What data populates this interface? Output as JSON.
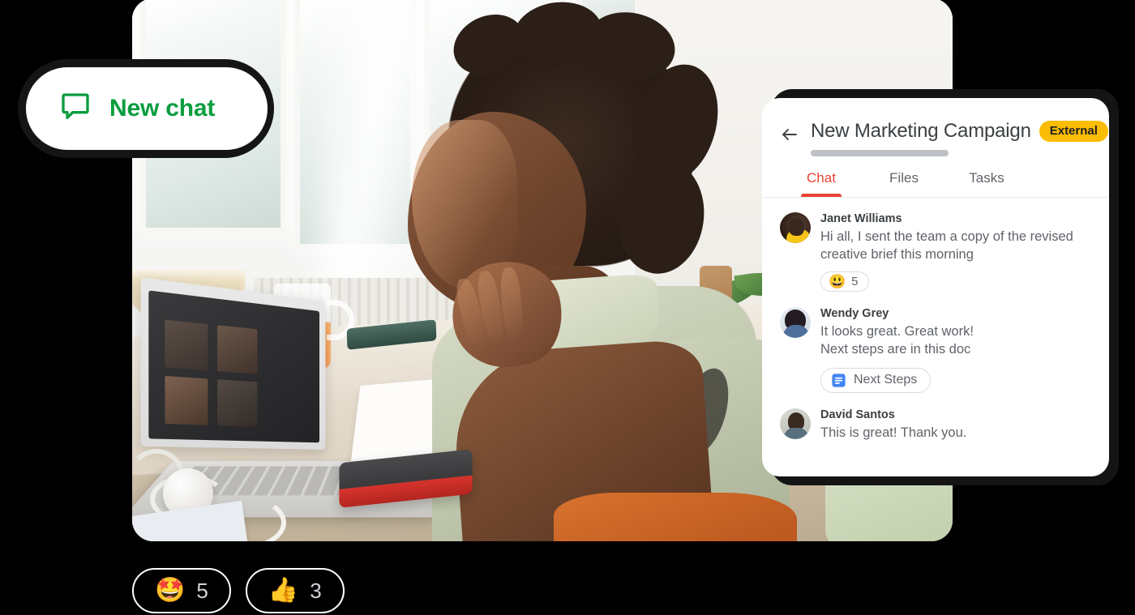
{
  "page": {
    "background_color": "#000000",
    "accent_green": "#0a9d3f",
    "accent_red": "#ea4335",
    "badge_yellow": "#fbbc04"
  },
  "new_chat_button": {
    "label": "New chat",
    "icon": "chat-bubble-icon",
    "text_color": "#0a9d3f"
  },
  "photo": {
    "alt": "Woman sitting at a bright home-office desk looking at an open laptop with a video call on screen"
  },
  "chat_card": {
    "back_icon": "back-arrow-icon",
    "title": "New Marketing Campaign",
    "badge": "External",
    "tabs": [
      {
        "label": "Chat",
        "active": true
      },
      {
        "label": "Files",
        "active": false
      },
      {
        "label": "Tasks",
        "active": false
      }
    ],
    "messages": [
      {
        "author": "Janet Williams",
        "avatar": "avatar-janet-williams",
        "text": "Hi all, I sent the team a copy of the revised creative brief this morning",
        "reaction": {
          "emoji": "😃",
          "emoji_name": "grinning-face-emoji",
          "count": "5"
        }
      },
      {
        "author": "Wendy Grey",
        "avatar": "avatar-wendy-grey",
        "text": "It looks great. Great work!\nNext steps are in this doc",
        "attachment": {
          "label": "Next Steps",
          "icon": "google-docs-icon"
        }
      },
      {
        "author": "David Santos",
        "avatar": "avatar-david-santos",
        "text": "This is great! Thank you."
      }
    ]
  },
  "bottom_reactions": [
    {
      "emoji": "🤩",
      "emoji_name": "star-struck-emoji",
      "count": "5"
    },
    {
      "emoji": "👍",
      "emoji_name": "thumbs-up-emoji",
      "count": "3"
    }
  ]
}
